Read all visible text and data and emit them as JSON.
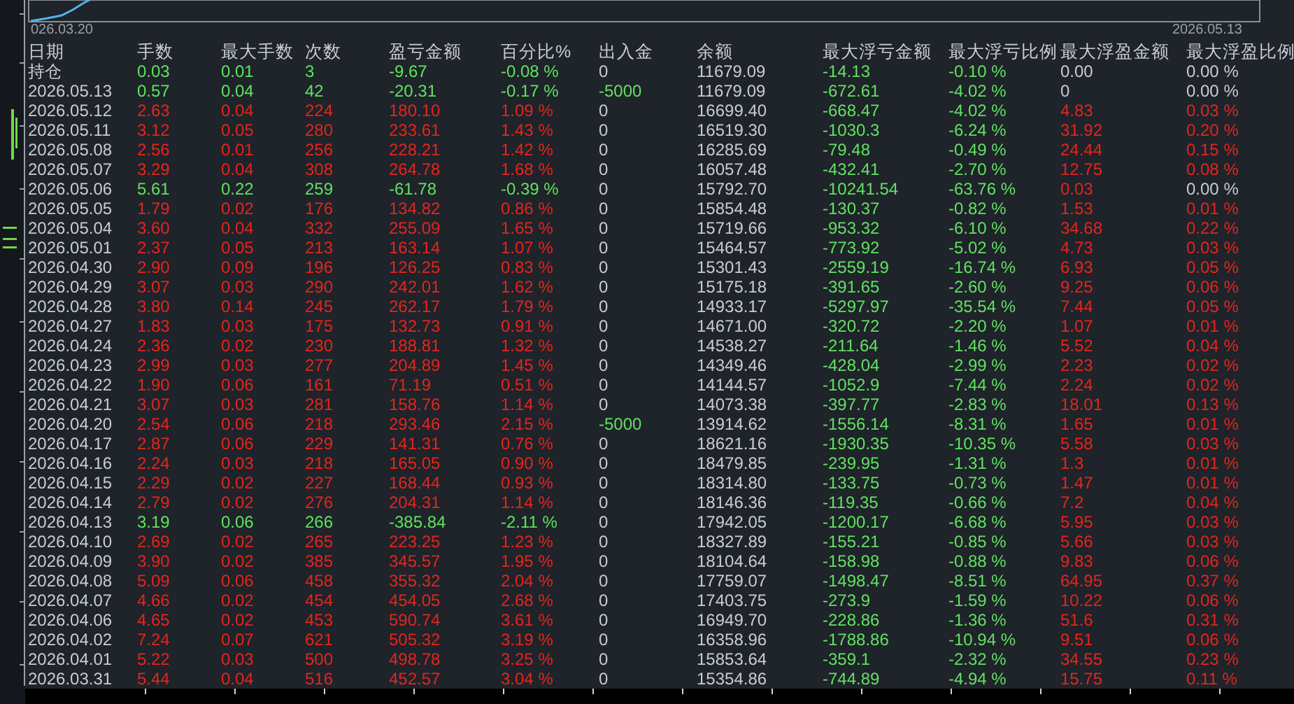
{
  "chart": {
    "start_label": "026.03.20",
    "end_label": "2026.05.13"
  },
  "table": {
    "columns": [
      "日期",
      "手数",
      "最大手数",
      "次数",
      "盈亏金额",
      "百分比%",
      "出入金",
      "余额",
      "最大浮亏金额",
      "最大浮亏比例",
      "最大浮盈金额",
      "最大浮盈比例"
    ],
    "rows": [
      {
        "cells": [
          "持仓",
          "0.03",
          "0.01",
          "3",
          "-9.67",
          "-0.08 %",
          "0",
          "11679.09",
          "-14.13",
          "-0.10 %",
          "0.00",
          "0.00 %"
        ],
        "day_loss": true,
        "cash_out": false,
        "float_profit_nonzero": false,
        "float_profit_pct_nonzero": false
      },
      {
        "cells": [
          "2026.05.13",
          "0.57",
          "0.04",
          "42",
          "-20.31",
          "-0.17 %",
          "-5000",
          "11679.09",
          "-672.61",
          "-4.02 %",
          "0",
          "0.00 %"
        ],
        "day_loss": true,
        "cash_out": true,
        "float_profit_nonzero": false,
        "float_profit_pct_nonzero": false
      },
      {
        "cells": [
          "2026.05.12",
          "2.63",
          "0.04",
          "224",
          "180.10",
          "1.09 %",
          "0",
          "16699.40",
          "-668.47",
          "-4.02 %",
          "4.83",
          "0.03 %"
        ],
        "day_loss": false,
        "cash_out": false,
        "float_profit_nonzero": true,
        "float_profit_pct_nonzero": true
      },
      {
        "cells": [
          "2026.05.11",
          "3.12",
          "0.05",
          "280",
          "233.61",
          "1.43 %",
          "0",
          "16519.30",
          "-1030.3",
          "-6.24 %",
          "31.92",
          "0.20 %"
        ],
        "day_loss": false,
        "cash_out": false,
        "float_profit_nonzero": true,
        "float_profit_pct_nonzero": true
      },
      {
        "cells": [
          "2026.05.08",
          "2.56",
          "0.01",
          "256",
          "228.21",
          "1.42 %",
          "0",
          "16285.69",
          "-79.48",
          "-0.49 %",
          "24.44",
          "0.15 %"
        ],
        "day_loss": false,
        "cash_out": false,
        "float_profit_nonzero": true,
        "float_profit_pct_nonzero": true
      },
      {
        "cells": [
          "2026.05.07",
          "3.29",
          "0.04",
          "308",
          "264.78",
          "1.68 %",
          "0",
          "16057.48",
          "-432.41",
          "-2.70 %",
          "12.75",
          "0.08 %"
        ],
        "day_loss": false,
        "cash_out": false,
        "float_profit_nonzero": true,
        "float_profit_pct_nonzero": true
      },
      {
        "cells": [
          "2026.05.06",
          "5.61",
          "0.22",
          "259",
          "-61.78",
          "-0.39 %",
          "0",
          "15792.70",
          "-10241.54",
          "-63.76 %",
          "0.03",
          "0.00 %"
        ],
        "day_loss": true,
        "cash_out": false,
        "float_profit_nonzero": true,
        "float_profit_pct_nonzero": false
      },
      {
        "cells": [
          "2026.05.05",
          "1.79",
          "0.02",
          "176",
          "134.82",
          "0.86 %",
          "0",
          "15854.48",
          "-130.37",
          "-0.82 %",
          "1.53",
          "0.01 %"
        ],
        "day_loss": false,
        "cash_out": false,
        "float_profit_nonzero": true,
        "float_profit_pct_nonzero": true
      },
      {
        "cells": [
          "2026.05.04",
          "3.60",
          "0.04",
          "332",
          "255.09",
          "1.65 %",
          "0",
          "15719.66",
          "-953.32",
          "-6.10 %",
          "34.68",
          "0.22 %"
        ],
        "day_loss": false,
        "cash_out": false,
        "float_profit_nonzero": true,
        "float_profit_pct_nonzero": true
      },
      {
        "cells": [
          "2026.05.01",
          "2.37",
          "0.05",
          "213",
          "163.14",
          "1.07 %",
          "0",
          "15464.57",
          "-773.92",
          "-5.02 %",
          "4.73",
          "0.03 %"
        ],
        "day_loss": false,
        "cash_out": false,
        "float_profit_nonzero": true,
        "float_profit_pct_nonzero": true
      },
      {
        "cells": [
          "2026.04.30",
          "2.90",
          "0.09",
          "196",
          "126.25",
          "0.83 %",
          "0",
          "15301.43",
          "-2559.19",
          "-16.74 %",
          "6.93",
          "0.05 %"
        ],
        "day_loss": false,
        "cash_out": false,
        "float_profit_nonzero": true,
        "float_profit_pct_nonzero": true
      },
      {
        "cells": [
          "2026.04.29",
          "3.07",
          "0.03",
          "290",
          "242.01",
          "1.62 %",
          "0",
          "15175.18",
          "-391.65",
          "-2.60 %",
          "9.25",
          "0.06 %"
        ],
        "day_loss": false,
        "cash_out": false,
        "float_profit_nonzero": true,
        "float_profit_pct_nonzero": true
      },
      {
        "cells": [
          "2026.04.28",
          "3.80",
          "0.14",
          "245",
          "262.17",
          "1.79 %",
          "0",
          "14933.17",
          "-5297.97",
          "-35.54 %",
          "7.44",
          "0.05 %"
        ],
        "day_loss": false,
        "cash_out": false,
        "float_profit_nonzero": true,
        "float_profit_pct_nonzero": true
      },
      {
        "cells": [
          "2026.04.27",
          "1.83",
          "0.03",
          "175",
          "132.73",
          "0.91 %",
          "0",
          "14671.00",
          "-320.72",
          "-2.20 %",
          "1.07",
          "0.01 %"
        ],
        "day_loss": false,
        "cash_out": false,
        "float_profit_nonzero": true,
        "float_profit_pct_nonzero": true
      },
      {
        "cells": [
          "2026.04.24",
          "2.36",
          "0.02",
          "230",
          "188.81",
          "1.32 %",
          "0",
          "14538.27",
          "-211.64",
          "-1.46 %",
          "5.52",
          "0.04 %"
        ],
        "day_loss": false,
        "cash_out": false,
        "float_profit_nonzero": true,
        "float_profit_pct_nonzero": true
      },
      {
        "cells": [
          "2026.04.23",
          "2.99",
          "0.03",
          "277",
          "204.89",
          "1.45 %",
          "0",
          "14349.46",
          "-428.04",
          "-2.99 %",
          "2.23",
          "0.02 %"
        ],
        "day_loss": false,
        "cash_out": false,
        "float_profit_nonzero": true,
        "float_profit_pct_nonzero": true
      },
      {
        "cells": [
          "2026.04.22",
          "1.90",
          "0.06",
          "161",
          "71.19",
          "0.51 %",
          "0",
          "14144.57",
          "-1052.9",
          "-7.44 %",
          "2.24",
          "0.02 %"
        ],
        "day_loss": false,
        "cash_out": false,
        "float_profit_nonzero": true,
        "float_profit_pct_nonzero": true
      },
      {
        "cells": [
          "2026.04.21",
          "3.07",
          "0.03",
          "281",
          "158.76",
          "1.14 %",
          "0",
          "14073.38",
          "-397.77",
          "-2.83 %",
          "18.01",
          "0.13 %"
        ],
        "day_loss": false,
        "cash_out": false,
        "float_profit_nonzero": true,
        "float_profit_pct_nonzero": true
      },
      {
        "cells": [
          "2026.04.20",
          "2.54",
          "0.06",
          "218",
          "293.46",
          "2.15 %",
          "-5000",
          "13914.62",
          "-1556.14",
          "-8.31 %",
          "1.65",
          "0.01 %"
        ],
        "day_loss": false,
        "cash_out": true,
        "float_profit_nonzero": true,
        "float_profit_pct_nonzero": true
      },
      {
        "cells": [
          "2026.04.17",
          "2.87",
          "0.06",
          "229",
          "141.31",
          "0.76 %",
          "0",
          "18621.16",
          "-1930.35",
          "-10.35 %",
          "5.58",
          "0.03 %"
        ],
        "day_loss": false,
        "cash_out": false,
        "float_profit_nonzero": true,
        "float_profit_pct_nonzero": true
      },
      {
        "cells": [
          "2026.04.16",
          "2.24",
          "0.03",
          "218",
          "165.05",
          "0.90 %",
          "0",
          "18479.85",
          "-239.95",
          "-1.31 %",
          "1.3",
          "0.01 %"
        ],
        "day_loss": false,
        "cash_out": false,
        "float_profit_nonzero": true,
        "float_profit_pct_nonzero": true
      },
      {
        "cells": [
          "2026.04.15",
          "2.29",
          "0.02",
          "227",
          "168.44",
          "0.93 %",
          "0",
          "18314.80",
          "-133.75",
          "-0.73 %",
          "1.47",
          "0.01 %"
        ],
        "day_loss": false,
        "cash_out": false,
        "float_profit_nonzero": true,
        "float_profit_pct_nonzero": true
      },
      {
        "cells": [
          "2026.04.14",
          "2.79",
          "0.02",
          "276",
          "204.31",
          "1.14 %",
          "0",
          "18146.36",
          "-119.35",
          "-0.66 %",
          "7.2",
          "0.04 %"
        ],
        "day_loss": false,
        "cash_out": false,
        "float_profit_nonzero": true,
        "float_profit_pct_nonzero": true
      },
      {
        "cells": [
          "2026.04.13",
          "3.19",
          "0.06",
          "266",
          "-385.84",
          "-2.11 %",
          "0",
          "17942.05",
          "-1200.17",
          "-6.68 %",
          "5.95",
          "0.03 %"
        ],
        "day_loss": true,
        "cash_out": false,
        "float_profit_nonzero": true,
        "float_profit_pct_nonzero": true
      },
      {
        "cells": [
          "2026.04.10",
          "2.69",
          "0.02",
          "265",
          "223.25",
          "1.23 %",
          "0",
          "18327.89",
          "-155.21",
          "-0.85 %",
          "5.66",
          "0.03 %"
        ],
        "day_loss": false,
        "cash_out": false,
        "float_profit_nonzero": true,
        "float_profit_pct_nonzero": true
      },
      {
        "cells": [
          "2026.04.09",
          "3.90",
          "0.02",
          "385",
          "345.57",
          "1.95 %",
          "0",
          "18104.64",
          "-158.98",
          "-0.88 %",
          "9.83",
          "0.06 %"
        ],
        "day_loss": false,
        "cash_out": false,
        "float_profit_nonzero": true,
        "float_profit_pct_nonzero": true
      },
      {
        "cells": [
          "2026.04.08",
          "5.09",
          "0.06",
          "458",
          "355.32",
          "2.04 %",
          "0",
          "17759.07",
          "-1498.47",
          "-8.51 %",
          "64.95",
          "0.37 %"
        ],
        "day_loss": false,
        "cash_out": false,
        "float_profit_nonzero": true,
        "float_profit_pct_nonzero": true
      },
      {
        "cells": [
          "2026.04.07",
          "4.66",
          "0.02",
          "454",
          "454.05",
          "2.68 %",
          "0",
          "17403.75",
          "-273.9",
          "-1.59 %",
          "10.22",
          "0.06 %"
        ],
        "day_loss": false,
        "cash_out": false,
        "float_profit_nonzero": true,
        "float_profit_pct_nonzero": true
      },
      {
        "cells": [
          "2026.04.06",
          "4.65",
          "0.02",
          "453",
          "590.74",
          "3.61 %",
          "0",
          "16949.70",
          "-228.86",
          "-1.36 %",
          "51.6",
          "0.31 %"
        ],
        "day_loss": false,
        "cash_out": false,
        "float_profit_nonzero": true,
        "float_profit_pct_nonzero": true
      },
      {
        "cells": [
          "2026.04.02",
          "7.24",
          "0.07",
          "621",
          "505.32",
          "3.19 %",
          "0",
          "16358.96",
          "-1788.86",
          "-10.94 %",
          "9.51",
          "0.06 %"
        ],
        "day_loss": false,
        "cash_out": false,
        "float_profit_nonzero": true,
        "float_profit_pct_nonzero": true
      },
      {
        "cells": [
          "2026.04.01",
          "5.22",
          "0.03",
          "500",
          "498.78",
          "3.25 %",
          "0",
          "15853.64",
          "-359.1",
          "-2.32 %",
          "34.55",
          "0.23 %"
        ],
        "day_loss": false,
        "cash_out": false,
        "float_profit_nonzero": true,
        "float_profit_pct_nonzero": true
      },
      {
        "cells": [
          "2026.03.31",
          "5.44",
          "0.04",
          "516",
          "452.57",
          "3.04 %",
          "0",
          "15354.86",
          "-744.89",
          "-4.94 %",
          "15.75",
          "0.11 %"
        ],
        "day_loss": false,
        "cash_out": false,
        "float_profit_nonzero": true,
        "float_profit_pct_nonzero": true
      }
    ]
  }
}
